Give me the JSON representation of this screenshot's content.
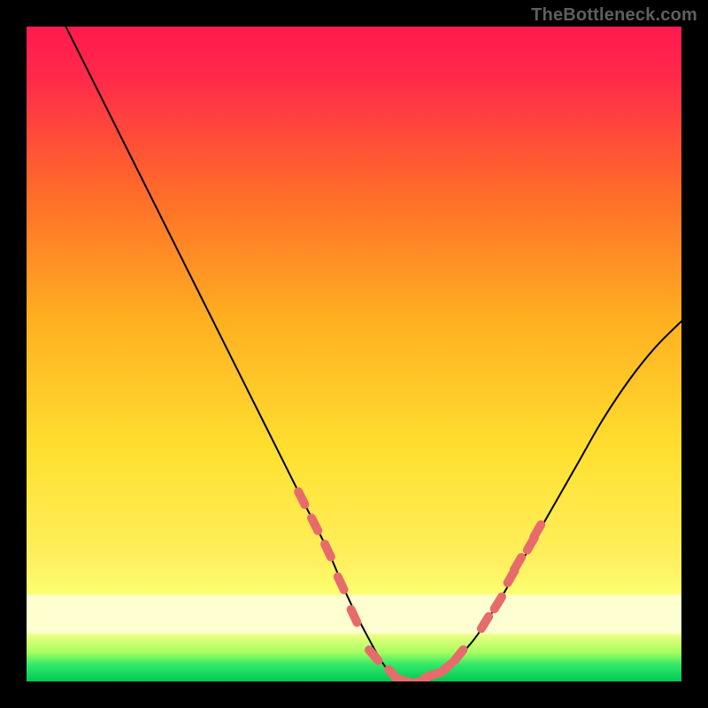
{
  "watermark": "TheBottleneck.com",
  "colors": {
    "black": "#000000",
    "curve": "#000000",
    "marker_fill": "#e86b6b",
    "marker_stroke": "#c94f4f",
    "grad_top": "#ff1a4f",
    "grad_mid1": "#ff7f2a",
    "grad_mid2": "#ffdf2a",
    "grad_low": "#f8ff8a",
    "grad_lower": "#dfff6a",
    "grad_green": "#00e060",
    "grad_green2": "#00c853"
  },
  "chart_data": {
    "type": "line",
    "title": "",
    "xlabel": "",
    "ylabel": "",
    "xlim": [
      0,
      100
    ],
    "ylim": [
      0,
      100
    ],
    "series": [
      {
        "name": "bottleneck-curve",
        "x": [
          6,
          10,
          14,
          18,
          22,
          26,
          30,
          34,
          38,
          42,
          46,
          49,
          52,
          55,
          58,
          61,
          64,
          68,
          72,
          76,
          80,
          84,
          88,
          92,
          96,
          100
        ],
        "y": [
          100,
          92,
          84,
          76,
          68,
          60,
          52,
          44,
          36,
          28,
          20,
          13,
          7,
          2,
          0,
          0,
          2,
          6,
          12,
          19,
          26,
          33,
          40,
          46,
          51,
          55
        ]
      }
    ],
    "markers": {
      "name": "highlighted-segments",
      "points": [
        {
          "x": 42,
          "y": 28
        },
        {
          "x": 44,
          "y": 24
        },
        {
          "x": 46,
          "y": 20
        },
        {
          "x": 48,
          "y": 15
        },
        {
          "x": 50,
          "y": 10
        },
        {
          "x": 53,
          "y": 4
        },
        {
          "x": 56,
          "y": 1
        },
        {
          "x": 58,
          "y": 0
        },
        {
          "x": 60,
          "y": 0
        },
        {
          "x": 62,
          "y": 1
        },
        {
          "x": 64,
          "y": 2
        },
        {
          "x": 66,
          "y": 4
        },
        {
          "x": 70,
          "y": 9
        },
        {
          "x": 72,
          "y": 12
        },
        {
          "x": 74,
          "y": 16
        },
        {
          "x": 75,
          "y": 18
        },
        {
          "x": 77,
          "y": 21
        },
        {
          "x": 78,
          "y": 23
        }
      ]
    },
    "bands": [
      {
        "name": "red-orange-yellow-gradient",
        "from_y": 13,
        "to_y": 100
      },
      {
        "name": "pale-yellow",
        "from_y": 6,
        "to_y": 13
      },
      {
        "name": "green",
        "from_y": 0,
        "to_y": 6
      }
    ]
  }
}
